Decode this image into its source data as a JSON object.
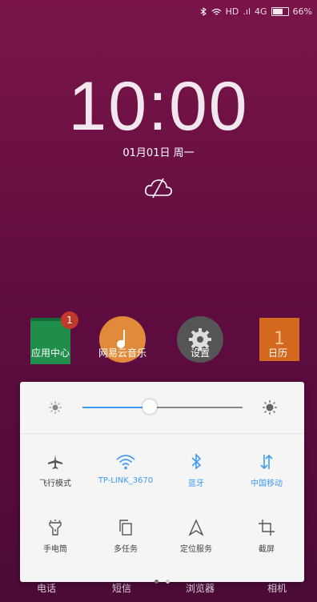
{
  "status": {
    "signal": "HD",
    "network": "4G",
    "battery": "66%"
  },
  "clock": {
    "time": "10:00",
    "date": "01月01日  周一"
  },
  "apps": [
    {
      "label": "应用中心",
      "badge": "1"
    },
    {
      "label": "网易云音乐"
    },
    {
      "label": "设置"
    },
    {
      "label": "日历"
    }
  ],
  "dock": [
    "电话",
    "短信",
    "浏览器",
    "相机"
  ],
  "panel": {
    "brightness": 0.42,
    "tiles": [
      {
        "label": "飞行模式",
        "icon": "airplane-icon",
        "active": false
      },
      {
        "label": "TP-LINK_3670",
        "icon": "wifi-icon",
        "active": true
      },
      {
        "label": "蓝牙",
        "icon": "bluetooth-icon",
        "active": true
      },
      {
        "label": "中国移动",
        "icon": "data-icon",
        "active": true
      },
      {
        "label": "手电筒",
        "icon": "flashlight-icon",
        "active": false
      },
      {
        "label": "多任务",
        "icon": "multitask-icon",
        "active": false
      },
      {
        "label": "定位服务",
        "icon": "location-icon",
        "active": false
      },
      {
        "label": "截屏",
        "icon": "screenshot-icon",
        "active": false
      }
    ],
    "page_dots": 2
  },
  "colors": {
    "accent": "#3e9af3"
  }
}
